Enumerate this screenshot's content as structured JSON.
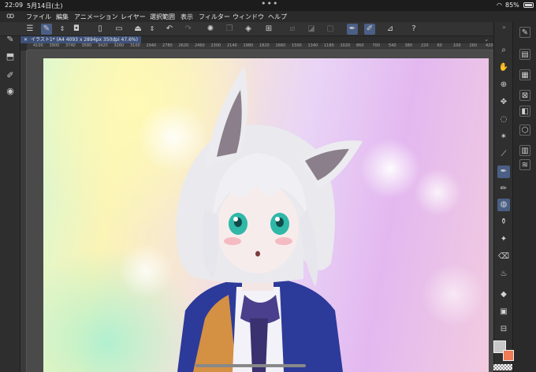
{
  "status_bar": {
    "time": "22:09",
    "date": "5月14日(土)",
    "dots": "•••",
    "wifi": "wifi-icon",
    "battery": "85%"
  },
  "menubar": {
    "items": [
      "ファイル",
      "編集",
      "アニメーション",
      "レイヤー",
      "選択範囲",
      "表示",
      "フィルター",
      "ウィンドウ",
      "ヘルプ"
    ]
  },
  "document": {
    "tab_title": "イラスト1* (A4 4093 x 2894px 350dpi 47.6%)"
  },
  "ruler": {
    "ticks": [
      "4100",
      "3900",
      "3740",
      "3580",
      "3420",
      "3260",
      "3100",
      "2940",
      "2780",
      "2620",
      "2460",
      "2300",
      "2140",
      "1980",
      "1820",
      "1660",
      "1500",
      "1340",
      "1180",
      "1020",
      "860",
      "700",
      "540",
      "380",
      "220",
      "60",
      "100",
      "260",
      "420"
    ]
  },
  "colors": {
    "main": "#c8c8c8",
    "sub": "#f07b54",
    "accent": "#4b5f86"
  }
}
